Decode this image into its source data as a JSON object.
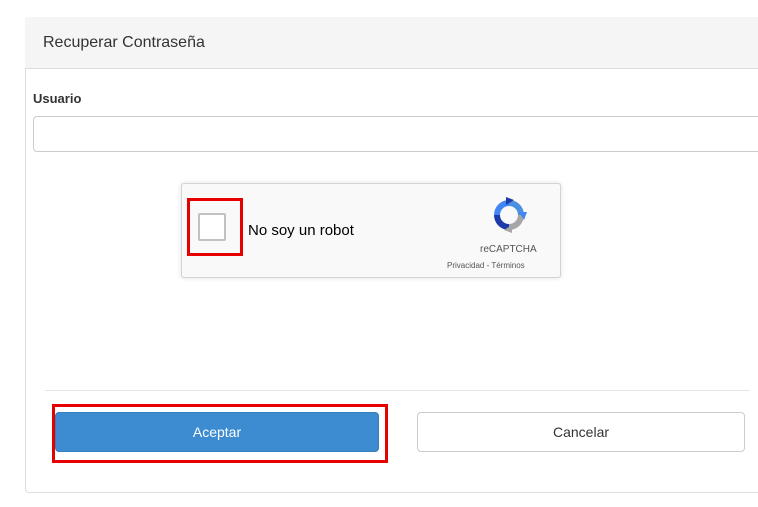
{
  "panel": {
    "title": "Recuperar Contraseña"
  },
  "form": {
    "username_label": "Usuario",
    "username_value": "",
    "username_placeholder": ""
  },
  "captcha": {
    "label": "No soy un robot",
    "brand": "reCAPTCHA",
    "privacy_link": "Privacidad",
    "separator": " - ",
    "terms_link": "Términos",
    "icon": "recaptcha-logo-icon"
  },
  "actions": {
    "accept_label": "Aceptar",
    "cancel_label": "Cancelar"
  },
  "colors": {
    "primary": "#3d8bd0",
    "highlight": "#e60000",
    "panel_header": "#f5f5f5"
  }
}
